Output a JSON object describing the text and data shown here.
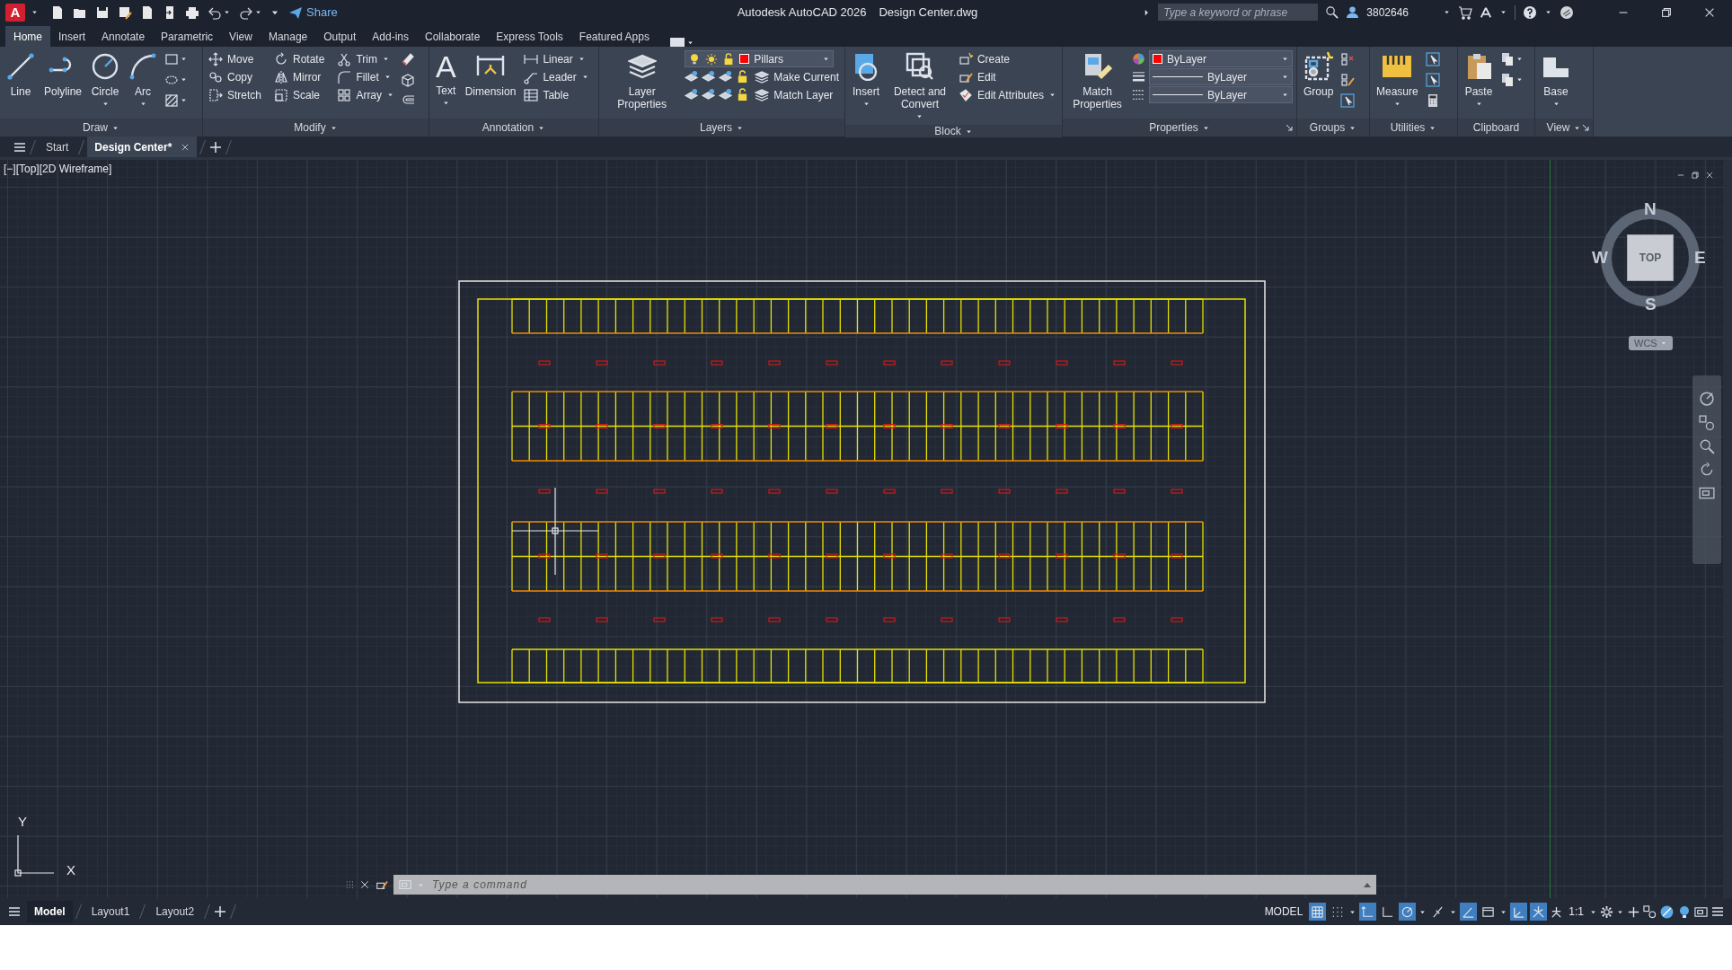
{
  "title_bar": {
    "app_letter": "A",
    "share": "Share",
    "title": "Autodesk AutoCAD 2026",
    "file": "Design Center.dwg",
    "search": {
      "placeholder": "Type a keyword or phrase"
    },
    "user": "3802646"
  },
  "ribbon_tabs": [
    {
      "label": "Home",
      "selected": true
    },
    {
      "label": "Insert",
      "selected": false
    },
    {
      "label": "Annotate",
      "selected": false
    },
    {
      "label": "Parametric",
      "selected": false
    },
    {
      "label": "View",
      "selected": false
    },
    {
      "label": "Manage",
      "selected": false
    },
    {
      "label": "Output",
      "selected": false
    },
    {
      "label": "Add-ins",
      "selected": false
    },
    {
      "label": "Collaborate",
      "selected": false
    },
    {
      "label": "Express Tools",
      "selected": false
    },
    {
      "label": "Featured Apps",
      "selected": false
    }
  ],
  "ribbon_panels": [
    {
      "title": "Draw",
      "caret": true,
      "large": [
        {
          "label": "Line",
          "caret": false
        },
        {
          "label": "Polyline",
          "caret": false
        },
        {
          "label": "Circle",
          "caret": true
        },
        {
          "label": "Arc",
          "caret": true
        }
      ]
    },
    {
      "title": "Modify",
      "caret": true,
      "small": [
        {
          "label": "Move",
          "caret": false
        },
        {
          "label": "Rotate",
          "caret": false
        },
        {
          "label": "Trim",
          "caret": true
        },
        {
          "label": "Copy",
          "caret": false
        },
        {
          "label": "Mirror",
          "caret": false
        },
        {
          "label": "Fillet",
          "caret": true
        },
        {
          "label": "Stretch",
          "caret": false
        },
        {
          "label": "Scale",
          "caret": false
        },
        {
          "label": "Array",
          "caret": true
        }
      ]
    },
    {
      "title": "Annotation",
      "caret": true,
      "large": [
        {
          "label": "Text",
          "caret": true,
          "glyph": "A"
        },
        {
          "label": "Dimension",
          "caret": false
        }
      ],
      "small": [
        {
          "label": "Linear",
          "caret": true
        },
        {
          "label": "Leader",
          "caret": true
        },
        {
          "label": "Table",
          "caret": false
        }
      ]
    },
    {
      "title": "Layers",
      "caret": true,
      "large": [
        {
          "label": "Layer Properties",
          "caret": false
        }
      ],
      "layer": {
        "value": "Pillars",
        "color": "#ff0000"
      },
      "small": [
        {
          "label": "Make Current",
          "caret": false
        },
        {
          "label": "Match Layer",
          "caret": false
        }
      ]
    },
    {
      "title": "Block",
      "caret": true,
      "large": [
        {
          "label": "Insert",
          "caret": true
        },
        {
          "label": "Detect and Convert",
          "caret": true
        }
      ],
      "small": [
        {
          "label": "Create",
          "caret": false
        },
        {
          "label": "Edit",
          "caret": false
        },
        {
          "label": "Edit Attributes",
          "caret": true
        }
      ]
    },
    {
      "title": "Properties",
      "caret": true,
      "launcher": true,
      "large": [
        {
          "label": "Match Properties",
          "caret": false
        }
      ],
      "dropdowns": [
        {
          "kind": "color",
          "value": "ByLayer",
          "color": "#ff0000"
        },
        {
          "kind": "lineweight",
          "value": "ByLayer"
        },
        {
          "kind": "linetype",
          "value": "ByLayer"
        }
      ]
    },
    {
      "title": "Groups",
      "caret": true,
      "large": [
        {
          "label": "Group",
          "caret": false
        }
      ]
    },
    {
      "title": "Utilities",
      "caret": true,
      "large": [
        {
          "label": "Measure",
          "caret": true
        }
      ]
    },
    {
      "title": "Clipboard",
      "caret": false,
      "large": [
        {
          "label": "Paste",
          "caret": true
        }
      ]
    },
    {
      "title": "View",
      "caret": true,
      "launcher": true,
      "large": [
        {
          "label": "Base",
          "caret": true
        }
      ]
    }
  ],
  "file_tabs": [
    {
      "label": "Start",
      "selected": false
    },
    {
      "label": "Design Center*",
      "selected": true
    }
  ],
  "viewport": {
    "label": "[−][Top][2D Wireframe]",
    "viewcube": {
      "north": "N",
      "west": "W",
      "east": "E",
      "south": "S",
      "face": "TOP",
      "ucs": "WCS"
    },
    "axes": {
      "y": "Y",
      "x": "X"
    }
  },
  "command_line": {
    "placeholder": "Type a command"
  },
  "layout_tabs": [
    {
      "label": "Model",
      "selected": true
    },
    {
      "label": "Layout1",
      "selected": false
    },
    {
      "label": "Layout2",
      "selected": false
    }
  ],
  "status_bar": {
    "mode": "MODEL",
    "scale": "1:1",
    "toggles": [
      {
        "on": true
      },
      {
        "on": false
      },
      {
        "on": true
      },
      {
        "on": false
      },
      {
        "on": true
      },
      {
        "on": false
      },
      {
        "on": true
      },
      {
        "on": false
      },
      {
        "on": true
      },
      {
        "on": true
      }
    ]
  }
}
